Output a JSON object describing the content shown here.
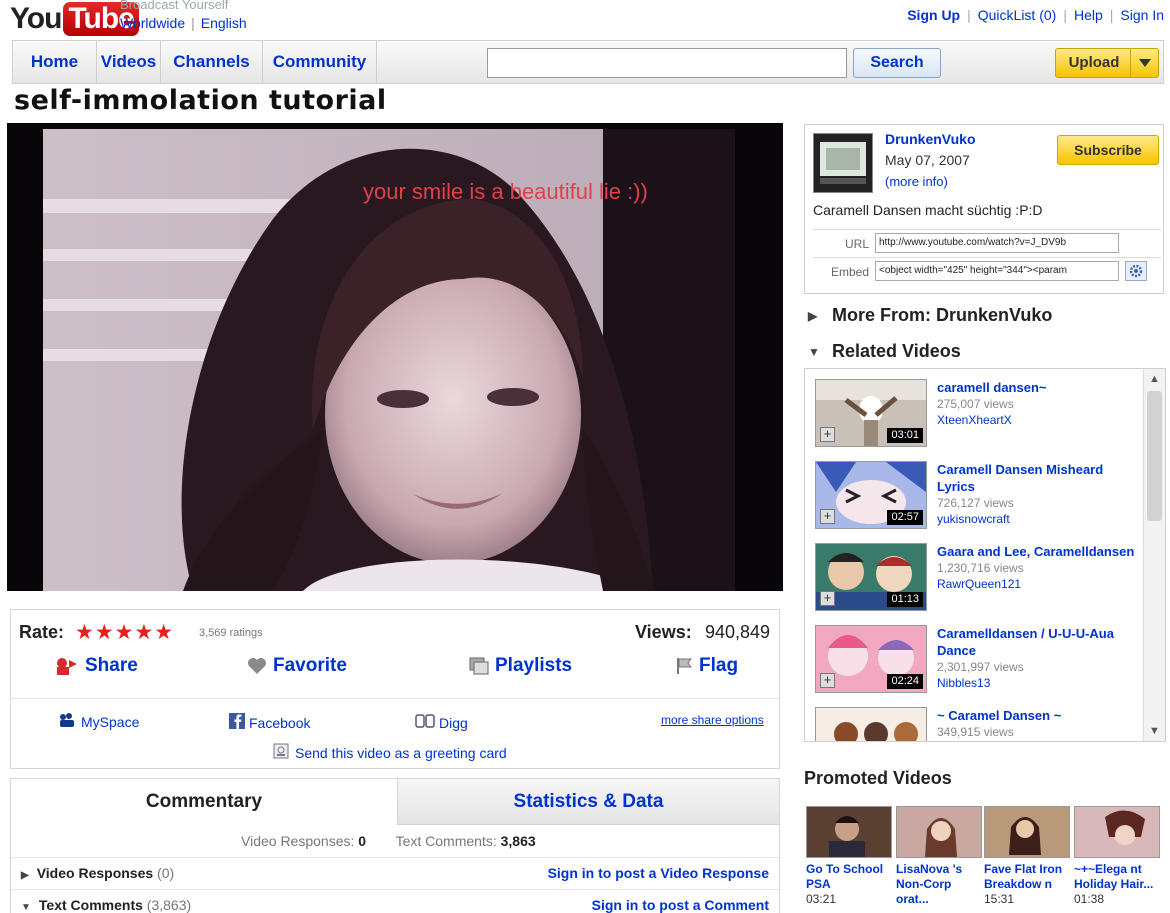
{
  "header": {
    "logo_you": "You",
    "logo_tube": "Tube",
    "tagline": "Broadcast Yourself",
    "locale_region": "Worldwide",
    "locale_language": "English",
    "links": {
      "sign_up": "Sign Up",
      "quicklist": "QuickList (0)",
      "help": "Help",
      "sign_in": "Sign In"
    }
  },
  "nav": {
    "tabs": [
      "Home",
      "Videos",
      "Channels",
      "Community"
    ],
    "search_value": "",
    "search_button": "Search",
    "upload_button": "Upload"
  },
  "video": {
    "title": "self-immolation tutorial",
    "overlay_caption": "your smile is a beautiful lie :))"
  },
  "channel": {
    "name": "DrunkenVuko",
    "date": "May 07, 2007",
    "more_info": "(more info)",
    "subscribe": "Subscribe",
    "description": "Caramell Dansen macht süchtig :P:D",
    "url_label": "URL",
    "url_value": "http://www.youtube.com/watch?v=J_DV9b",
    "embed_label": "Embed",
    "embed_value": "<object width=\"425\" height=\"344\"><param"
  },
  "sections": {
    "more_from": "More From: DrunkenVuko",
    "related": "Related Videos",
    "promoted": "Promoted Videos"
  },
  "related_videos": [
    {
      "title": "caramell dansen~",
      "views": "275,007 views",
      "user": "XteenXheartX",
      "duration": "03:01"
    },
    {
      "title": "Caramell Dansen Misheard Lyrics",
      "views": "726,127 views",
      "user": "yukisnowcraft",
      "duration": "02:57"
    },
    {
      "title": "Gaara and Lee, Caramelldansen",
      "views": "1,230,716 views",
      "user": "RawrQueen121",
      "duration": "01:13"
    },
    {
      "title": "Caramelldansen / U-U-U-Aua Dance",
      "views": "2,301,997 views",
      "user": "Nibbles13",
      "duration": "02:24"
    },
    {
      "title": "~ Caramel Dansen ~",
      "views": "349,915 views",
      "user": "",
      "duration": ""
    }
  ],
  "promoted_videos": [
    {
      "title": "Go To School PSA",
      "time": "03:21"
    },
    {
      "title": "LisaNova 's Non-Corp orat...",
      "time": ""
    },
    {
      "title": "Fave Flat Iron Breakdow n",
      "time": "15:31"
    },
    {
      "title": "~+~Elega nt Holiday Hair...",
      "time": "01:38"
    }
  ],
  "actions": {
    "rate_label": "Rate:",
    "stars": "★★★★★",
    "rating": 5,
    "ratings_count": "3,569 ratings",
    "views_label": "Views:",
    "views_value": "940,849",
    "share": "Share",
    "favorite": "Favorite",
    "playlists": "Playlists",
    "flag": "Flag",
    "myspace": "MySpace",
    "facebook": "Facebook",
    "digg": "Digg",
    "more_share": "more share options",
    "greeting": "Send this video as a greeting card"
  },
  "comments": {
    "tab_commentary": "Commentary",
    "tab_stats": "Statistics & Data",
    "video_responses_label": "Video Responses:",
    "video_responses_count": "0",
    "text_comments_label": "Text Comments:",
    "text_comments_count": "3,863",
    "row_video_responses": "Video Responses",
    "row_video_responses_count": "(0)",
    "row_text_comments": "Text Comments",
    "row_text_comments_count": "(3,863)",
    "signin_video_response": "Sign in to post a Video Response",
    "signin_comment": "Sign in to post a Comment"
  },
  "colors": {
    "link": "#0033cc",
    "logo_red": "#cc0000",
    "star_red": "#e8201c",
    "button_yellow": "#f6c500"
  }
}
